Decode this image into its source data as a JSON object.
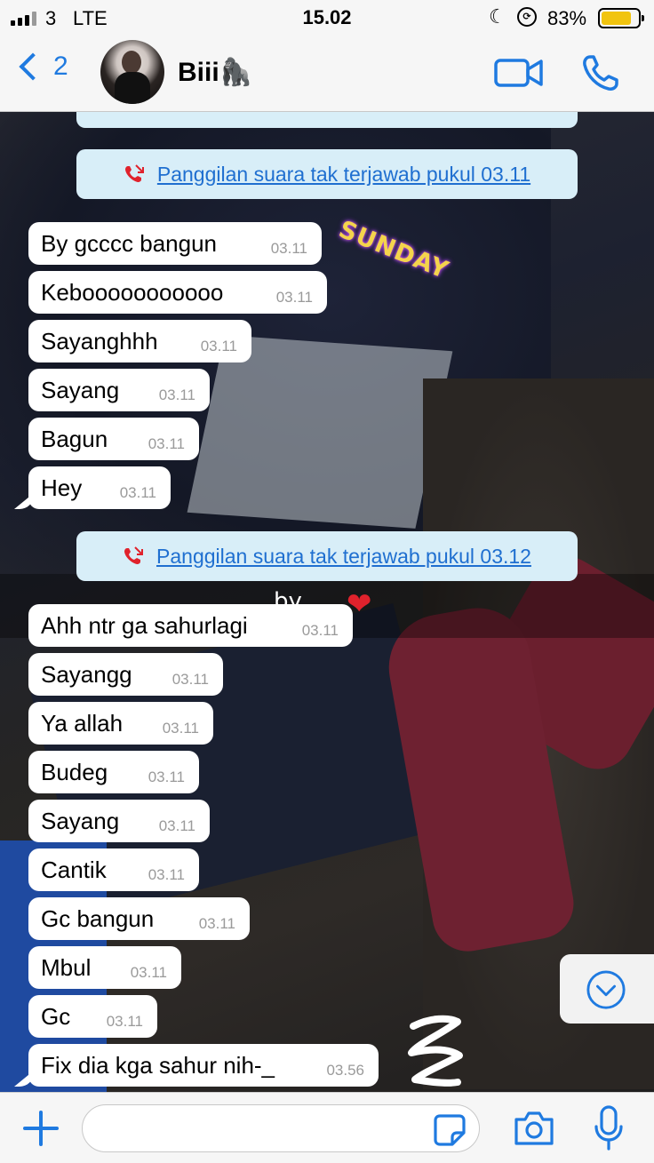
{
  "status_bar": {
    "carrier": "3",
    "network": "LTE",
    "time": "15.02",
    "battery_percent": "83%",
    "battery_level": 0.83,
    "icons": [
      "signal-icon",
      "moon-icon",
      "rotation-lock-icon",
      "battery-icon"
    ]
  },
  "header": {
    "back_count": "2",
    "contact_name": "Biii🦍",
    "icons": [
      "back-chevron-icon",
      "video-call-icon",
      "voice-call-icon"
    ]
  },
  "stickers": {
    "sunday": "SUNDAY",
    "by": "by",
    "heart": "❤"
  },
  "chat": {
    "missed_calls": [
      {
        "label": "Panggilan suara tak terjawab pukul 03.11"
      },
      {
        "label": "Panggilan suara tak terjawab pukul 03.12"
      }
    ],
    "messages_group_1": [
      {
        "text": "By gcccc bangun",
        "time": "03.11"
      },
      {
        "text": "Kebooooooooooo",
        "time": "03.11"
      },
      {
        "text": "Sayanghhh",
        "time": "03.11"
      },
      {
        "text": "Sayang",
        "time": "03.11"
      },
      {
        "text": "Bagun",
        "time": "03.11"
      },
      {
        "text": "Hey",
        "time": "03.11"
      }
    ],
    "messages_group_2": [
      {
        "text": "Ahh ntr ga sahurlagi",
        "time": "03.11"
      },
      {
        "text": "Sayangg",
        "time": "03.11"
      },
      {
        "text": "Ya allah",
        "time": "03.11"
      },
      {
        "text": "Budeg",
        "time": "03.11"
      },
      {
        "text": "Sayang",
        "time": "03.11"
      },
      {
        "text": "Cantik",
        "time": "03.11"
      },
      {
        "text": "Gc bangun",
        "time": "03.11"
      },
      {
        "text": "Mbul",
        "time": "03.11"
      },
      {
        "text": "Gc",
        "time": "03.11"
      },
      {
        "text": "Fix dia kga sahur nih-_",
        "time": "03.56"
      }
    ]
  },
  "input_bar": {
    "placeholder": "",
    "value": "",
    "icons": [
      "plus-icon",
      "sticker-icon",
      "camera-icon",
      "microphone-icon"
    ]
  },
  "colors": {
    "accent": "#1f7ae0",
    "system_bubble": "#d8eef8",
    "incoming_bubble": "#ffffff",
    "timestamp": "#9a9a9a",
    "battery": "#f1c40f"
  }
}
